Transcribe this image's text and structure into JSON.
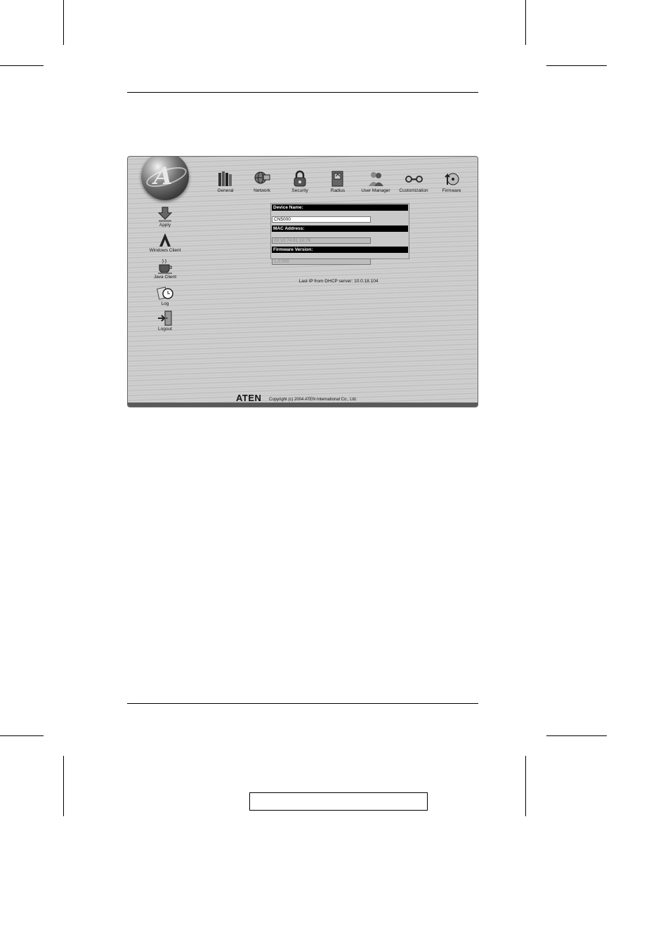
{
  "nav": {
    "items": [
      {
        "key": "general",
        "label": "General",
        "icon": "books-icon"
      },
      {
        "key": "network",
        "label": "Network",
        "icon": "globe-network-icon"
      },
      {
        "key": "security",
        "label": "Security",
        "icon": "padlock-icon"
      },
      {
        "key": "radius",
        "label": "Radius",
        "icon": "radius-server-icon"
      },
      {
        "key": "user-manager",
        "label": "User Manager",
        "icon": "users-icon"
      },
      {
        "key": "customization",
        "label": "Customization",
        "icon": "wrench-icon"
      },
      {
        "key": "firmware",
        "label": "Firmware",
        "icon": "firmware-disk-icon"
      }
    ]
  },
  "side": {
    "items": [
      {
        "key": "apply",
        "label": "Apply",
        "icon": "apply-arrow-icon"
      },
      {
        "key": "windows-client",
        "label": "Windows Client",
        "icon": "windows-client-icon"
      },
      {
        "key": "java-client",
        "label": "Java Client",
        "icon": "java-cup-icon"
      },
      {
        "key": "log",
        "label": "Log",
        "icon": "log-clock-icon"
      },
      {
        "key": "logout",
        "label": "Logout",
        "icon": "logout-door-icon"
      }
    ]
  },
  "form": {
    "device_name_label": "Device Name:",
    "device_name_value": "CN5000",
    "mac_label": "MAC Address:",
    "mac_value": "00:10:74:81:10:79",
    "firmware_label": "Firmware Version:",
    "firmware_value": "1.0.000"
  },
  "dhcp_text": "Last IP from DHCP server: 10.0.18.104",
  "footer": {
    "brand": "ATEN",
    "copyright": "Copyright (c) 2004 ATEN International Co., Ltd."
  }
}
